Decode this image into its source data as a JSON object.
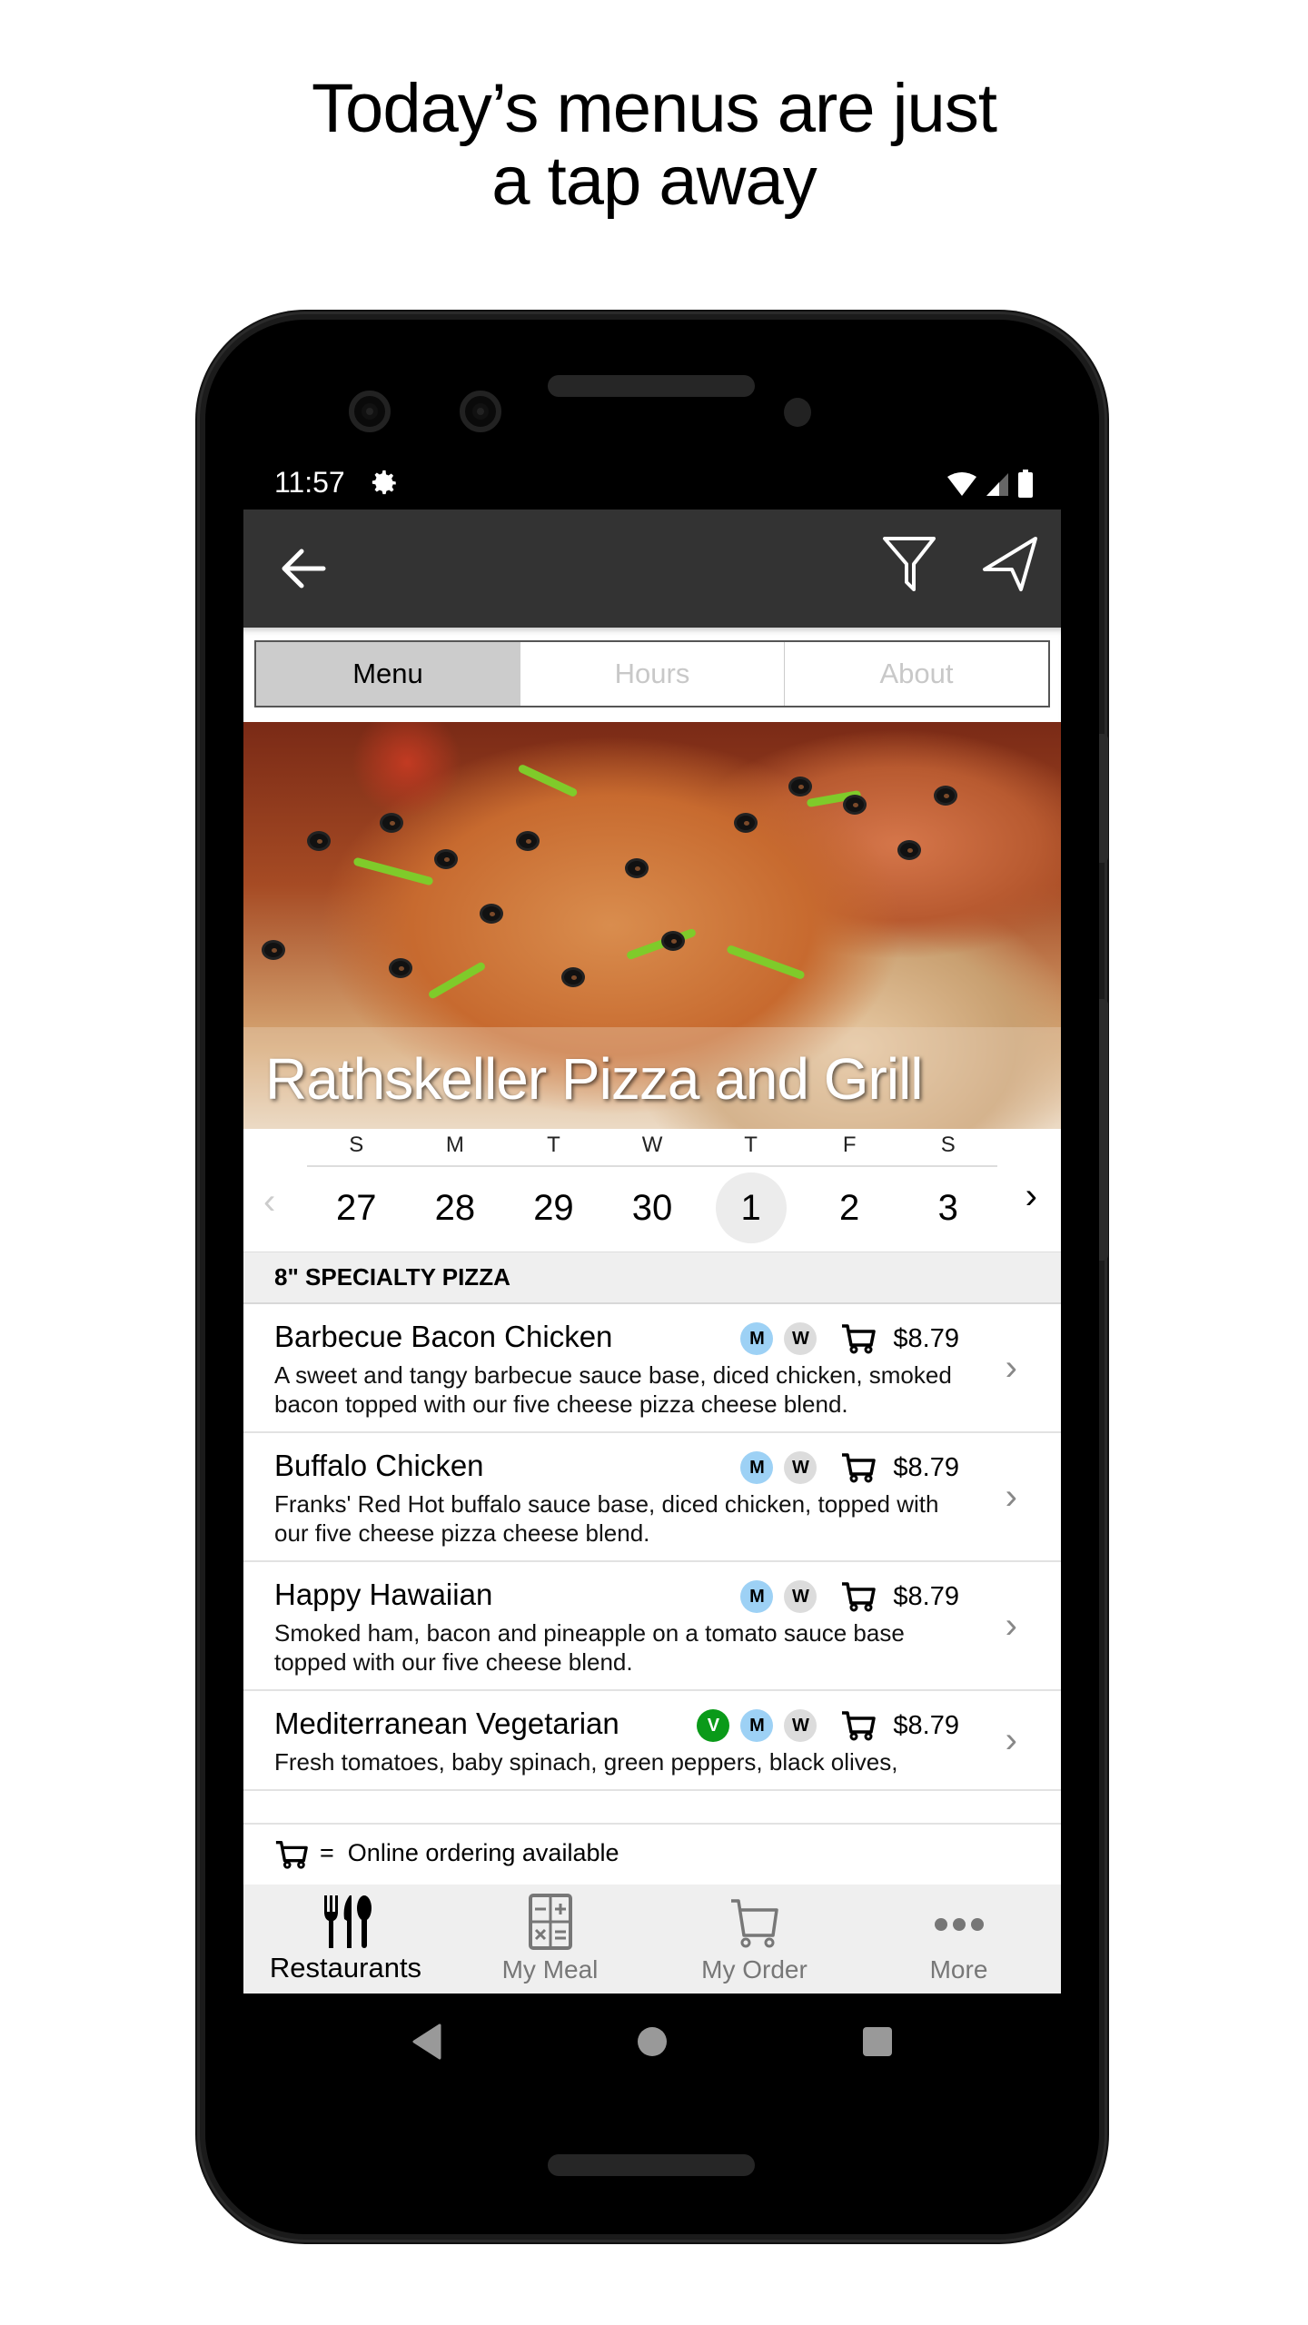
{
  "headline": {
    "line1": "Today’s menus are just",
    "line2": "a tap away"
  },
  "status_bar": {
    "time": "11:57",
    "icons": [
      "gear-icon",
      "wifi-icon",
      "signal-icon",
      "battery-icon"
    ]
  },
  "app_bar": {
    "back_icon": "arrow-left-icon",
    "actions": [
      "filter-icon",
      "navigation-arrow-icon"
    ]
  },
  "tabs": [
    {
      "label": "Menu",
      "active": true
    },
    {
      "label": "Hours",
      "active": false
    },
    {
      "label": "About",
      "active": false
    }
  ],
  "hero": {
    "restaurant_name": "Rathskeller Pizza and Grill"
  },
  "calendar": {
    "weekdays": [
      "S",
      "M",
      "T",
      "W",
      "T",
      "F",
      "S"
    ],
    "dates": [
      "27",
      "28",
      "29",
      "30",
      "1",
      "2",
      "3"
    ],
    "selected_index": 4,
    "prev_icon": "‹",
    "next_icon": "›"
  },
  "section": {
    "title": "8\" SPECIALTY PIZZA"
  },
  "menu_items": [
    {
      "name": "Barbecue Bacon Chicken",
      "badges": [
        "M",
        "W"
      ],
      "price": "$8.79",
      "description": "A sweet and tangy barbecue sauce base, diced chicken, smoked bacon topped with our five cheese pizza cheese blend."
    },
    {
      "name": "Buffalo Chicken",
      "badges": [
        "M",
        "W"
      ],
      "price": "$8.79",
      "description": "Franks' Red Hot buffalo sauce base, diced chicken, topped with our five cheese pizza cheese blend."
    },
    {
      "name": "Happy Hawaiian",
      "badges": [
        "M",
        "W"
      ],
      "price": "$8.79",
      "description": "Smoked ham, bacon and pineapple on a tomato sauce base topped with our five cheese blend."
    },
    {
      "name": "Mediterranean Vegetarian",
      "badges": [
        "V",
        "M",
        "W"
      ],
      "price": "$8.79",
      "description": "Fresh tomatoes, baby spinach, green peppers, black olives,"
    }
  ],
  "legend": {
    "equals": "=",
    "text": "Online ordering available"
  },
  "bottom_nav": [
    {
      "label": "Restaurants",
      "icon": "utensils-icon",
      "active": true
    },
    {
      "label": "My Meal",
      "icon": "calculator-icon",
      "active": false
    },
    {
      "label": "My Order",
      "icon": "cart-icon",
      "active": false
    },
    {
      "label": "More",
      "icon": "more-dots-icon",
      "active": false
    }
  ],
  "colors": {
    "app_bar": "#333333",
    "badge_vegetarian": "#0a9a19",
    "badge_m": "#9dd1f5",
    "badge_w": "#dcdcdc",
    "tab_active": "#cccccc"
  }
}
